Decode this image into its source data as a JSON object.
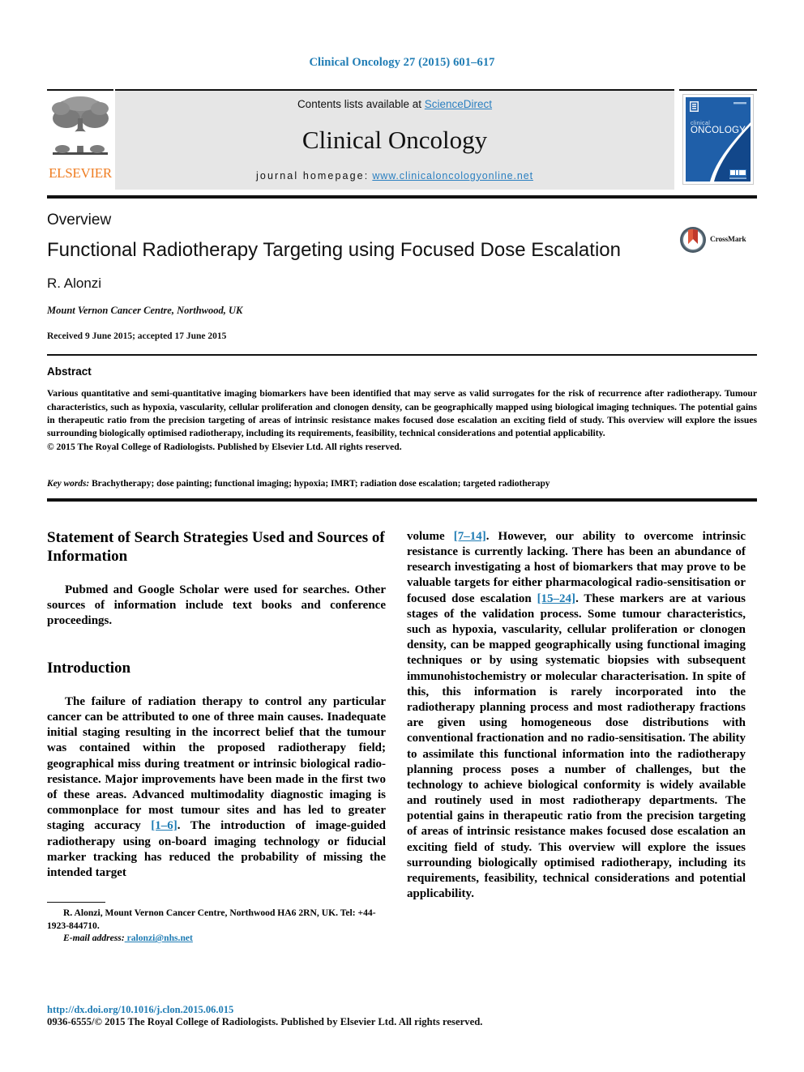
{
  "running_head": "Clinical Oncology 27 (2015) 601–617",
  "masthead": {
    "publisher_logo_label": "ELSEVIER",
    "contents_prefix": "Contents lists available at ",
    "contents_link": "ScienceDirect",
    "journal_name": "Clinical Oncology",
    "homepage_label": "journal homepage:",
    "homepage_url": "www.clinicaloncologyonline.net",
    "cover_title_small": "clinical",
    "cover_title_large": "ONCOLOGY"
  },
  "article": {
    "doctype": "Overview",
    "title": "Functional Radiotherapy Targeting using Focused Dose Escalation",
    "authors": "R. Alonzi",
    "affiliation": "Mount Vernon Cancer Centre, Northwood, UK",
    "history": "Received 9 June 2015; accepted 17 June 2015",
    "crossmark_label": "CrossMark"
  },
  "abstract": {
    "heading": "Abstract",
    "text": "Various quantitative and semi-quantitative imaging biomarkers have been identified that may serve as valid surrogates for the risk of recurrence after radiotherapy. Tumour characteristics, such as hypoxia, vascularity, cellular proliferation and clonogen density, can be geographically mapped using biological imaging techniques. The potential gains in therapeutic ratio from the precision targeting of areas of intrinsic resistance makes focused dose escalation an exciting field of study. This overview will explore the issues surrounding biologically optimised radiotherapy, including its requirements, feasibility, technical considerations and potential applicability.",
    "copyright": "© 2015 The Royal College of Radiologists. Published by Elsevier Ltd. All rights reserved.",
    "keywords_label": "Key words:",
    "keywords_text": " Brachytherapy; dose painting; functional imaging; hypoxia; IMRT; radiation dose escalation; targeted radiotherapy"
  },
  "body": {
    "left": {
      "heading_1": "Statement of Search Strategies Used and Sources of Information",
      "paragraph_1": "Pubmed and Google Scholar were used for searches. Other sources of information include text books and conference proceedings.",
      "heading_2": "Introduction",
      "paragraph_2a": "The failure of radiation therapy to control any particular cancer can be attributed to one of three main causes. Inadequate initial staging resulting in the incorrect belief that the tumour was contained within the proposed radiotherapy field; geographical miss during treatment or intrinsic biological radio-resistance. Major improvements have been made in the first two of these areas. Advanced multimodality diagnostic imaging is commonplace for most tumour sites and has led to greater staging accuracy ",
      "ref_1": "[1–6]",
      "paragraph_2b": ". The introduction of image-guided radiotherapy using on-board imaging technology or fiducial marker tracking has reduced the probability of missing the intended target"
    },
    "right": {
      "paragraph_3a": "volume ",
      "ref_2": "[7–14]",
      "paragraph_3b": ". However, our ability to overcome intrinsic resistance is currently lacking. There has been an abundance of research investigating a host of biomarkers that may prove to be valuable targets for either pharmacological radio-sensitisation or focused dose escalation ",
      "ref_3": "[15–24]",
      "paragraph_3c": ". These markers are at various stages of the validation process. Some tumour characteristics, such as hypoxia, vascularity, cellular proliferation or clonogen density, can be mapped geographically using functional imaging techniques or by using systematic biopsies with subsequent immunohistochemistry or molecular characterisation. In spite of this, this information is rarely incorporated into the radiotherapy planning process and most radiotherapy fractions are given using homogeneous dose distributions with conventional fractionation and no radio-sensitisation. The ability to assimilate this functional information into the radiotherapy planning process poses a number of challenges, but the technology to achieve biological conformity is widely available and routinely used in most radiotherapy departments. The potential gains in therapeutic ratio from the precision targeting of areas of intrinsic resistance makes focused dose escalation an exciting field of study. This overview will explore the issues surrounding biologically optimised radiotherapy, including its requirements, feasibility, technical considerations and potential applicability."
    }
  },
  "footnote": {
    "correspondence": "R. Alonzi, Mount Vernon Cancer Centre, Northwood HA6 2RN, UK. Tel: +44-1923-844710.",
    "email_label": "E-mail address:",
    "email_address": " ralonzi@nhs.net"
  },
  "footer": {
    "doi_url": "http://dx.doi.org/10.1016/j.clon.2015.06.015",
    "issn_line": "0936-6555/© 2015 The Royal College of Radiologists. Published by Elsevier Ltd. All rights reserved."
  },
  "colors": {
    "link_blue": "#1f7cb4",
    "sd_blue": "#2a7fc0",
    "elsevier_orange": "#ef7d22",
    "masthead_grey": "#e6e6e6",
    "cover_blue": "#1f5fa9"
  }
}
